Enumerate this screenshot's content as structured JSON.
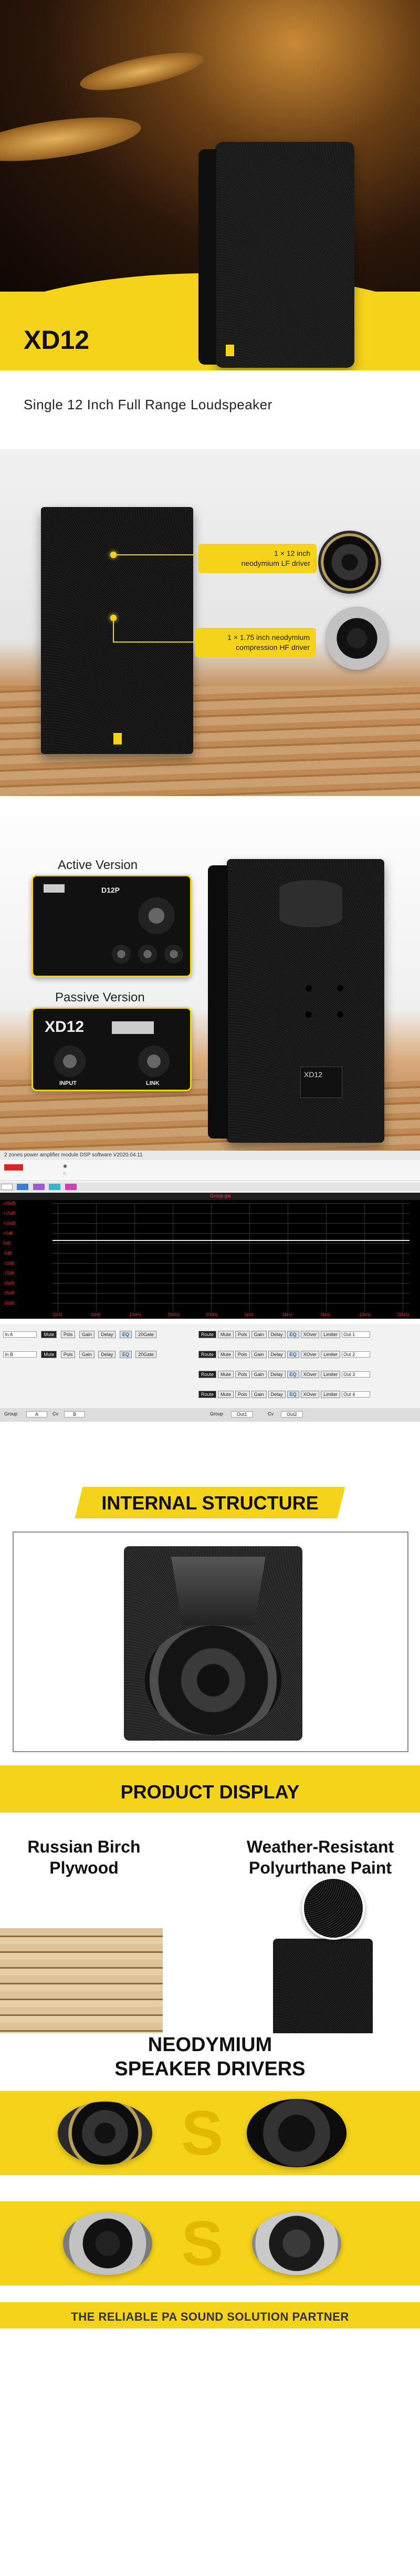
{
  "hero": {
    "model": "XD12",
    "subtitle": "Single 12 Inch Full Range Loudspeaker"
  },
  "drivers": {
    "lf_label": "1 × 12 inch\nneodymium LF driver",
    "hf_label": "1 × 1.75 inch neodymium\ncompression HF driver"
  },
  "versions": {
    "active_label": "Active Version",
    "passive_label": "Passive Version",
    "active_model": "D12P",
    "passive_model": "XD12",
    "passive_input": "INPUT",
    "passive_link": "LINK",
    "speaker_plate": "XD12"
  },
  "software": {
    "window_title": "2 zones power amplifier module DSP software V2020.04.11",
    "graph_title": "Group gai",
    "y_labels": [
      "+20dB",
      "+15dB",
      "+10dB",
      "+5dB",
      "0dB",
      "-5dB",
      "-10dB",
      "-15dB",
      "-20dB",
      "-25dB",
      "-30dB"
    ],
    "x_labels": [
      "20Hz",
      "50Hz",
      "100Hz",
      "200Hz",
      "500Hz",
      "1kHz",
      "2kHz",
      "5kHz",
      "10kHz",
      "20kHz"
    ],
    "input_rows": [
      "In A",
      "In B"
    ],
    "input_buttons": [
      "Mute",
      "Pols",
      "Gain",
      "Delay",
      "EQ",
      "20Gate"
    ],
    "output_buttons": [
      "Route",
      "Mute",
      "Pols",
      "Gain",
      "Delay",
      "EQ",
      "XOver",
      "Limiter"
    ],
    "output_rows": [
      "Out 1",
      "Out 2",
      "Out 3",
      "Out 4"
    ],
    "bottom_left": [
      "Group",
      "A",
      "Cv",
      "B"
    ],
    "bottom_right": [
      "Group",
      "Out1",
      "Cv",
      "Out2"
    ]
  },
  "structure": {
    "heading": "INTERNAL STRUCTURE"
  },
  "display": {
    "heading": "PRODUCT DISPLAY",
    "left_title": "Russian Birch\nPlywood",
    "right_title": "Weather-Resistant\nPolyurthane Paint"
  },
  "neo": {
    "heading": "NEODYMIUM\nSPEAKER DRIVERS",
    "footer": "THE RELIABLE PA SOUND SOLUTION PARTNER"
  },
  "colors": {
    "brand_yellow": "#f5d31a",
    "dark": "#111111"
  },
  "icons": [
    "logo-s-icon"
  ]
}
